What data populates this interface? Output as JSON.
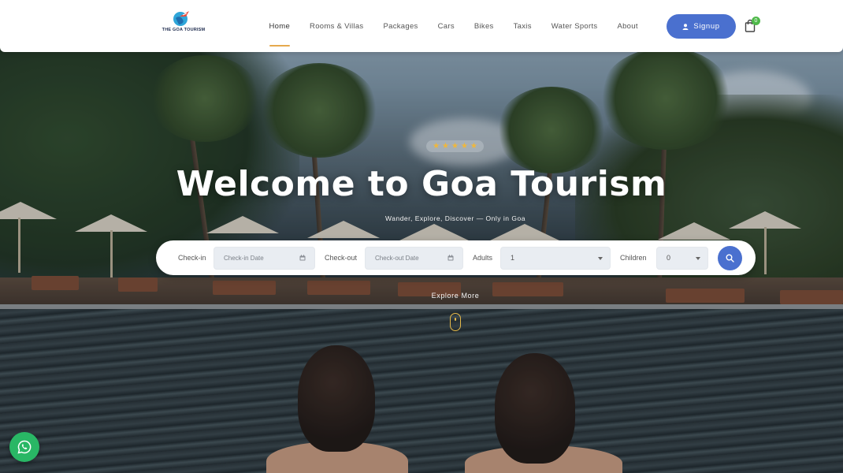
{
  "brand": {
    "logo_text": "THE GOA TOURISM",
    "accent": "#4a70cf",
    "highlight": "#e5a94d"
  },
  "nav": {
    "items": [
      {
        "label": "Home",
        "active": true
      },
      {
        "label": "Rooms & Villas"
      },
      {
        "label": "Packages"
      },
      {
        "label": "Cars"
      },
      {
        "label": "Bikes"
      },
      {
        "label": "Taxis"
      },
      {
        "label": "Water Sports"
      },
      {
        "label": "About"
      }
    ],
    "signup_label": "Signup",
    "cart_count": "0",
    "icons": {
      "user": "user-icon",
      "cart": "shopping-bag-icon"
    }
  },
  "hero": {
    "rating_stars": 5,
    "title": "Welcome to Goa Tourism",
    "subtitle": "Wander, Explore, Discover — Only in Goa",
    "explore_label": "Explore More"
  },
  "booking": {
    "checkin_label": "Check-in",
    "checkin_placeholder": "Check-in Date",
    "checkout_label": "Check-out",
    "checkout_placeholder": "Check-out Date",
    "adults_label": "Adults",
    "adults_value": "1",
    "children_label": "Children",
    "children_value": "0",
    "icons": {
      "calendar": "calendar-icon",
      "search": "search-icon"
    }
  },
  "floating": {
    "whatsapp_icon": "whatsapp-icon",
    "whatsapp_color": "#29b765"
  }
}
